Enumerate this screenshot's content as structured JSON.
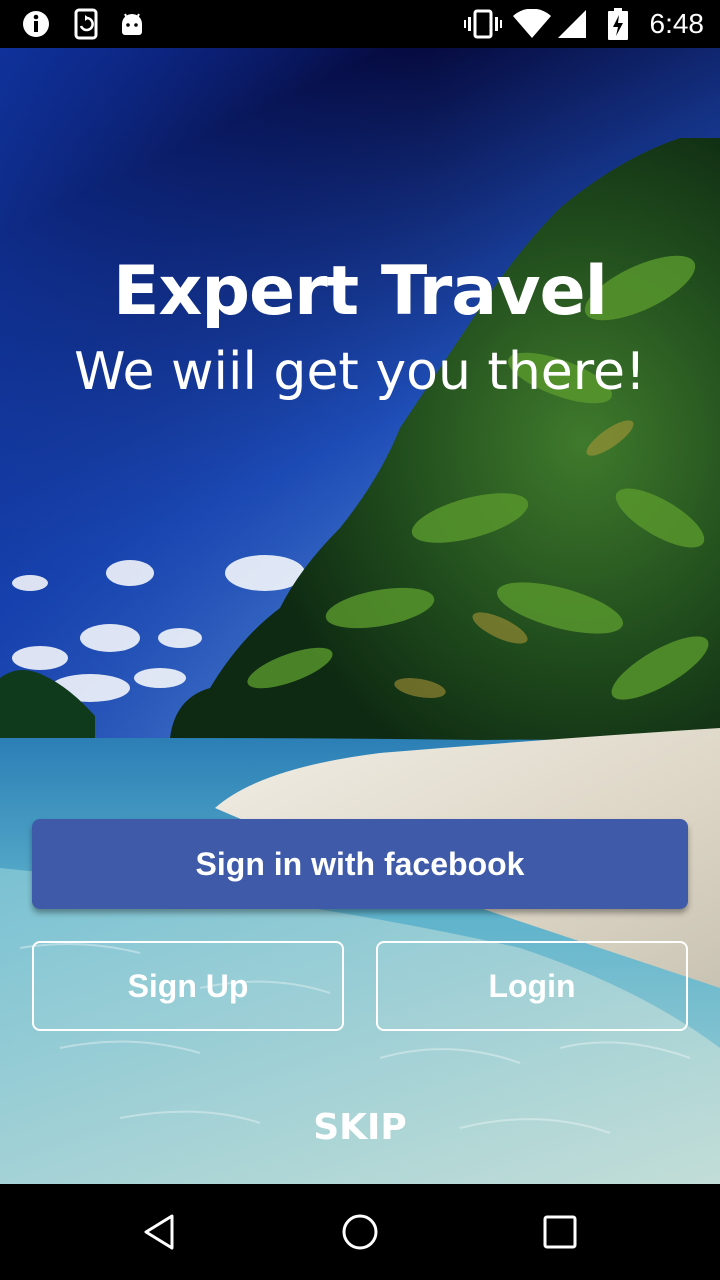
{
  "status_bar": {
    "time": "6:48",
    "icons": [
      "info-icon",
      "screen-rotation-icon",
      "android-icon",
      "vibrate-icon",
      "wifi-icon",
      "signal-icon",
      "battery-charging-icon"
    ]
  },
  "app": {
    "title": "Expert Travel",
    "tagline": "We wiil get you there!"
  },
  "actions": {
    "facebook_label": "Sign in with facebook",
    "signup_label": "Sign Up",
    "login_label": "Login",
    "skip_label": "SKIP"
  },
  "nav_bar": {
    "icons": [
      "back-icon",
      "home-icon",
      "recents-icon"
    ]
  },
  "colors": {
    "facebook_button": "#3f5aa9",
    "sky_top": "#05083a",
    "sky_mid": "#1f4fb8",
    "sea": "#2c8fb8",
    "sand": "#e9e6dc"
  }
}
